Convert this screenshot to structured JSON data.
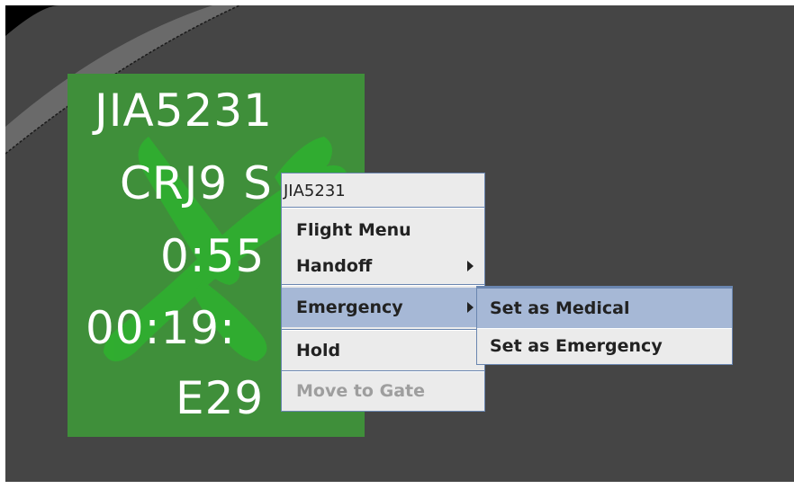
{
  "flight_strip": {
    "lines": [
      "JIA5231",
      "CRJ9 S",
      "0:55",
      "00:19:",
      "E29"
    ],
    "background_color": "#3f8f3a"
  },
  "context_menu": {
    "title": "JIA5231",
    "items": [
      {
        "label": "Flight Menu",
        "has_submenu": false,
        "enabled": true,
        "highlighted": false
      },
      {
        "label": "Handoff",
        "has_submenu": true,
        "enabled": true,
        "highlighted": false
      },
      {
        "label": "Emergency",
        "has_submenu": true,
        "enabled": true,
        "highlighted": true
      },
      {
        "label": "Hold",
        "has_submenu": false,
        "enabled": true,
        "highlighted": false
      },
      {
        "label": "Move to Gate",
        "has_submenu": false,
        "enabled": false,
        "highlighted": false
      }
    ]
  },
  "submenu": {
    "items": [
      {
        "label": "Set as Medical",
        "highlighted": true
      },
      {
        "label": "Set as Emergency",
        "highlighted": false
      }
    ]
  },
  "colors": {
    "map_background": "#454545",
    "menu_background": "#ebebeb",
    "menu_border": "#6a86b0",
    "highlight": "#a6b8d6"
  }
}
